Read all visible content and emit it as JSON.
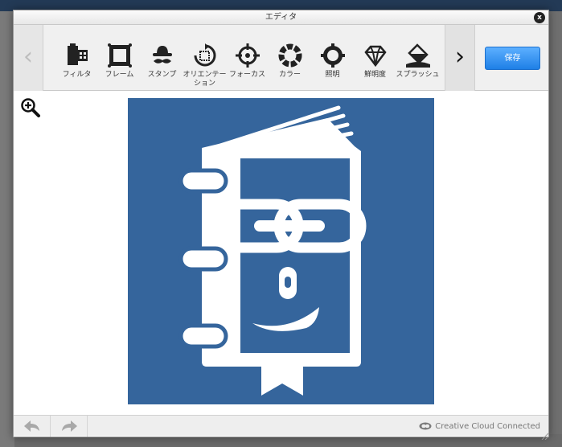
{
  "editor": {
    "title": "エディタ",
    "close_label": "x",
    "save_label": "保存",
    "status_text": "Creative Cloud Connected"
  },
  "toolbar": {
    "tools": [
      {
        "id": "filter",
        "label": "フィルタ",
        "icon": "film-icon"
      },
      {
        "id": "frame",
        "label": "フレーム",
        "icon": "frame-icon"
      },
      {
        "id": "stamp",
        "label": "スタンプ",
        "icon": "hat-mustache-icon"
      },
      {
        "id": "orientation",
        "label": "オリエンテーション",
        "icon": "rotate-icon"
      },
      {
        "id": "focus",
        "label": "フォーカス",
        "icon": "crosshair-icon"
      },
      {
        "id": "color",
        "label": "カラー",
        "icon": "color-ring-icon"
      },
      {
        "id": "lighting",
        "label": "照明",
        "icon": "sun-icon"
      },
      {
        "id": "sharpness",
        "label": "鮮明度",
        "icon": "diamond-icon"
      },
      {
        "id": "splash",
        "label": "スプラッシュ",
        "icon": "paint-bucket-icon"
      }
    ]
  },
  "image": {
    "background_color": "#35659c",
    "icon": "notebook-chain-glasses-icon"
  },
  "colors": {
    "accent": "#1e7fe6",
    "artwork_blue": "#35659c"
  }
}
